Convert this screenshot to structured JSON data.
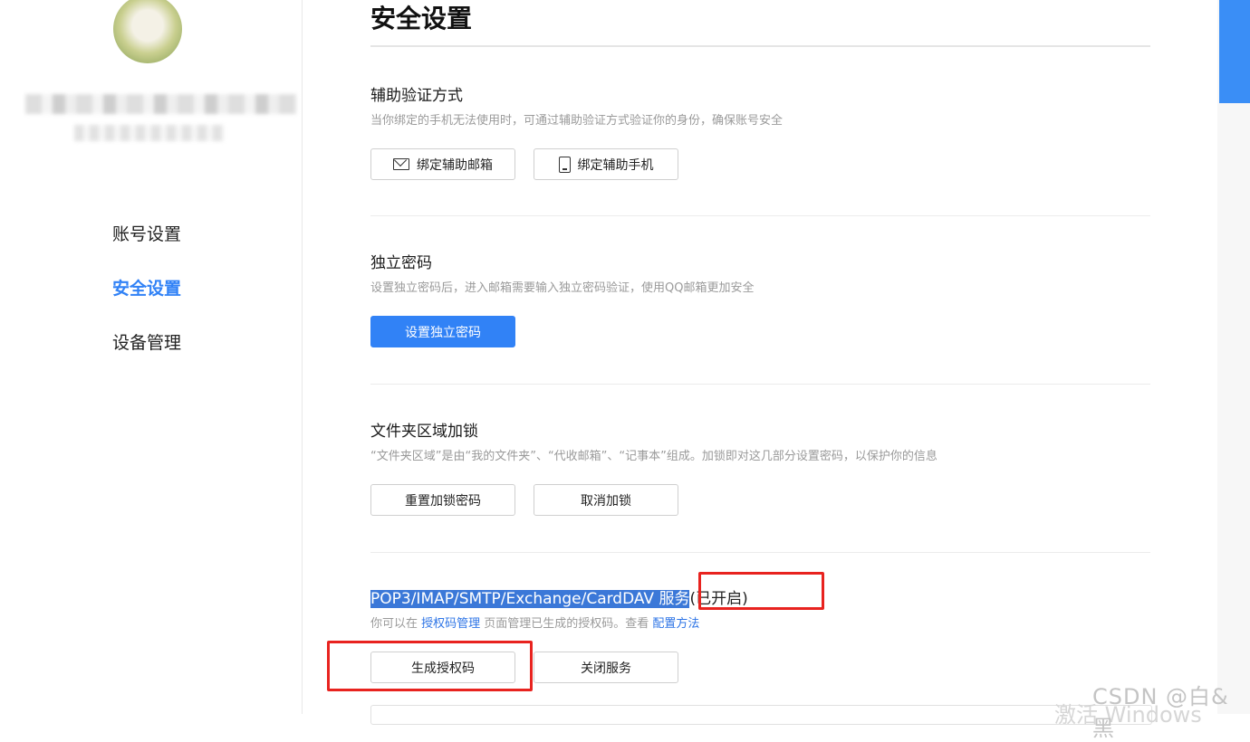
{
  "sidebar": {
    "nav": [
      {
        "label": "账号设置",
        "active": false
      },
      {
        "label": "安全设置",
        "active": true
      },
      {
        "label": "设备管理",
        "active": false
      }
    ]
  },
  "main": {
    "title": "安全设置",
    "sections": [
      {
        "title": "辅助验证方式",
        "desc": "当你绑定的手机无法使用时，可通过辅助验证方式验证你的身份，确保账号安全",
        "buttons": [
          {
            "label": "绑定辅助邮箱",
            "icon": "mail-icon"
          },
          {
            "label": "绑定辅助手机",
            "icon": "phone-icon"
          }
        ]
      },
      {
        "title": "独立密码",
        "desc": "设置独立密码后，进入邮箱需要输入独立密码验证，使用QQ邮箱更加安全",
        "buttons": [
          {
            "label": "设置独立密码",
            "primary": true
          }
        ]
      },
      {
        "title": "文件夹区域加锁",
        "desc": "“文件夹区域”是由“我的文件夹”、“代收邮箱”、“记事本”组成。加锁即对这几部分设置密码，以保护你的信息",
        "buttons": [
          {
            "label": "重置加锁密码"
          },
          {
            "label": "取消加锁"
          }
        ]
      },
      {
        "title": "POP3/IMAP/SMTP/Exchange/CardDAV 服务",
        "status": "(已开启)",
        "desc_prefix": "你可以在 ",
        "desc_link1": "授权码管理",
        "desc_middle": " 页面管理已生成的授权码。查看 ",
        "desc_link2": "配置方法",
        "buttons": [
          {
            "label": "生成授权码"
          },
          {
            "label": "关闭服务"
          }
        ]
      }
    ]
  },
  "watermarks": {
    "csdn": "CSDN @白&黑",
    "windows": "激活 Windows"
  },
  "colors": {
    "accent": "#3182f6",
    "annotation": "#e8231f",
    "selection": "#3b78d8"
  }
}
